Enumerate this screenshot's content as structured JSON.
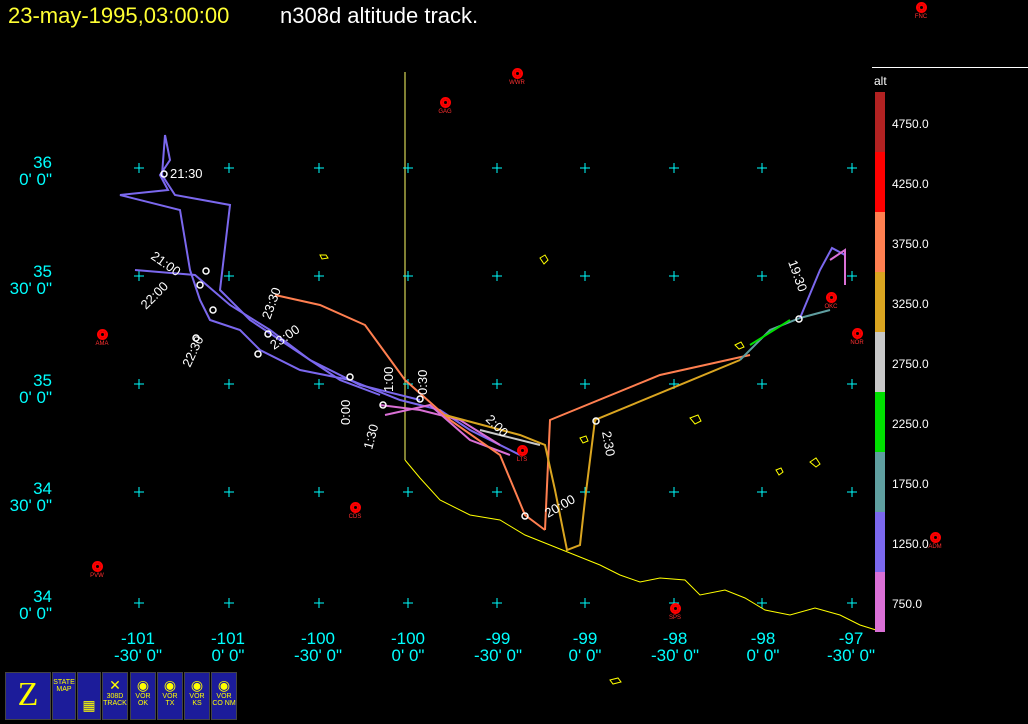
{
  "header": {
    "date_time": "23-may-1995,03:00:00",
    "title": "n308d altitude track."
  },
  "lat_labels": [
    {
      "deg": "36",
      "min": "0' 0\""
    },
    {
      "deg": "35",
      "min": "30' 0\""
    },
    {
      "deg": "35",
      "min": "0' 0\""
    },
    {
      "deg": "34",
      "min": "30' 0\""
    },
    {
      "deg": "34",
      "min": "0' 0\""
    }
  ],
  "lon_labels": [
    {
      "deg": "-101",
      "min": "-30' 0\""
    },
    {
      "deg": "-101",
      "min": "0' 0\""
    },
    {
      "deg": "-100",
      "min": "-30' 0\""
    },
    {
      "deg": "-100",
      "min": "0' 0\""
    },
    {
      "deg": "-99",
      "min": "-30' 0\""
    },
    {
      "deg": "-99",
      "min": "0' 0\""
    },
    {
      "deg": "-98",
      "min": "-30' 0\""
    },
    {
      "deg": "-98",
      "min": "0' 0\""
    },
    {
      "deg": "-97",
      "min": "-30' 0\""
    }
  ],
  "stations": [
    "FNC",
    "WWR",
    "GAG",
    "AMA",
    "CDS",
    "PVW",
    "SPS",
    "ADM",
    "NOR",
    "OKC",
    "LTS"
  ],
  "time_labels": [
    "21:30",
    "21:00",
    "22:00",
    "22:30",
    "23:00",
    "23:30",
    "0:00",
    "0:30",
    "1:00",
    "1:30",
    "2:00",
    "2:30",
    "19:30",
    "20:00"
  ],
  "legend": {
    "title": "alt",
    "values": [
      "4750.0",
      "4250.0",
      "3750.0",
      "3250.0",
      "2750.0",
      "2250.0",
      "1750.0",
      "1250.0",
      "750.0"
    ],
    "colors": [
      "#b22222",
      "#ff0000",
      "#ff7f50",
      "#daa520",
      "#c8c8c8",
      "#00e000",
      "#5f9ea0",
      "#7b68ee",
      "#da70d6"
    ]
  },
  "toolbar": {
    "logo": "Z",
    "state_map": "STATE MAP",
    "track": "308D TRACK",
    "vor_ok": "VOR OK",
    "vor_tx": "VOR TX",
    "vor_ks": "VOR KS",
    "vor_conm": "VOR CO NM"
  }
}
